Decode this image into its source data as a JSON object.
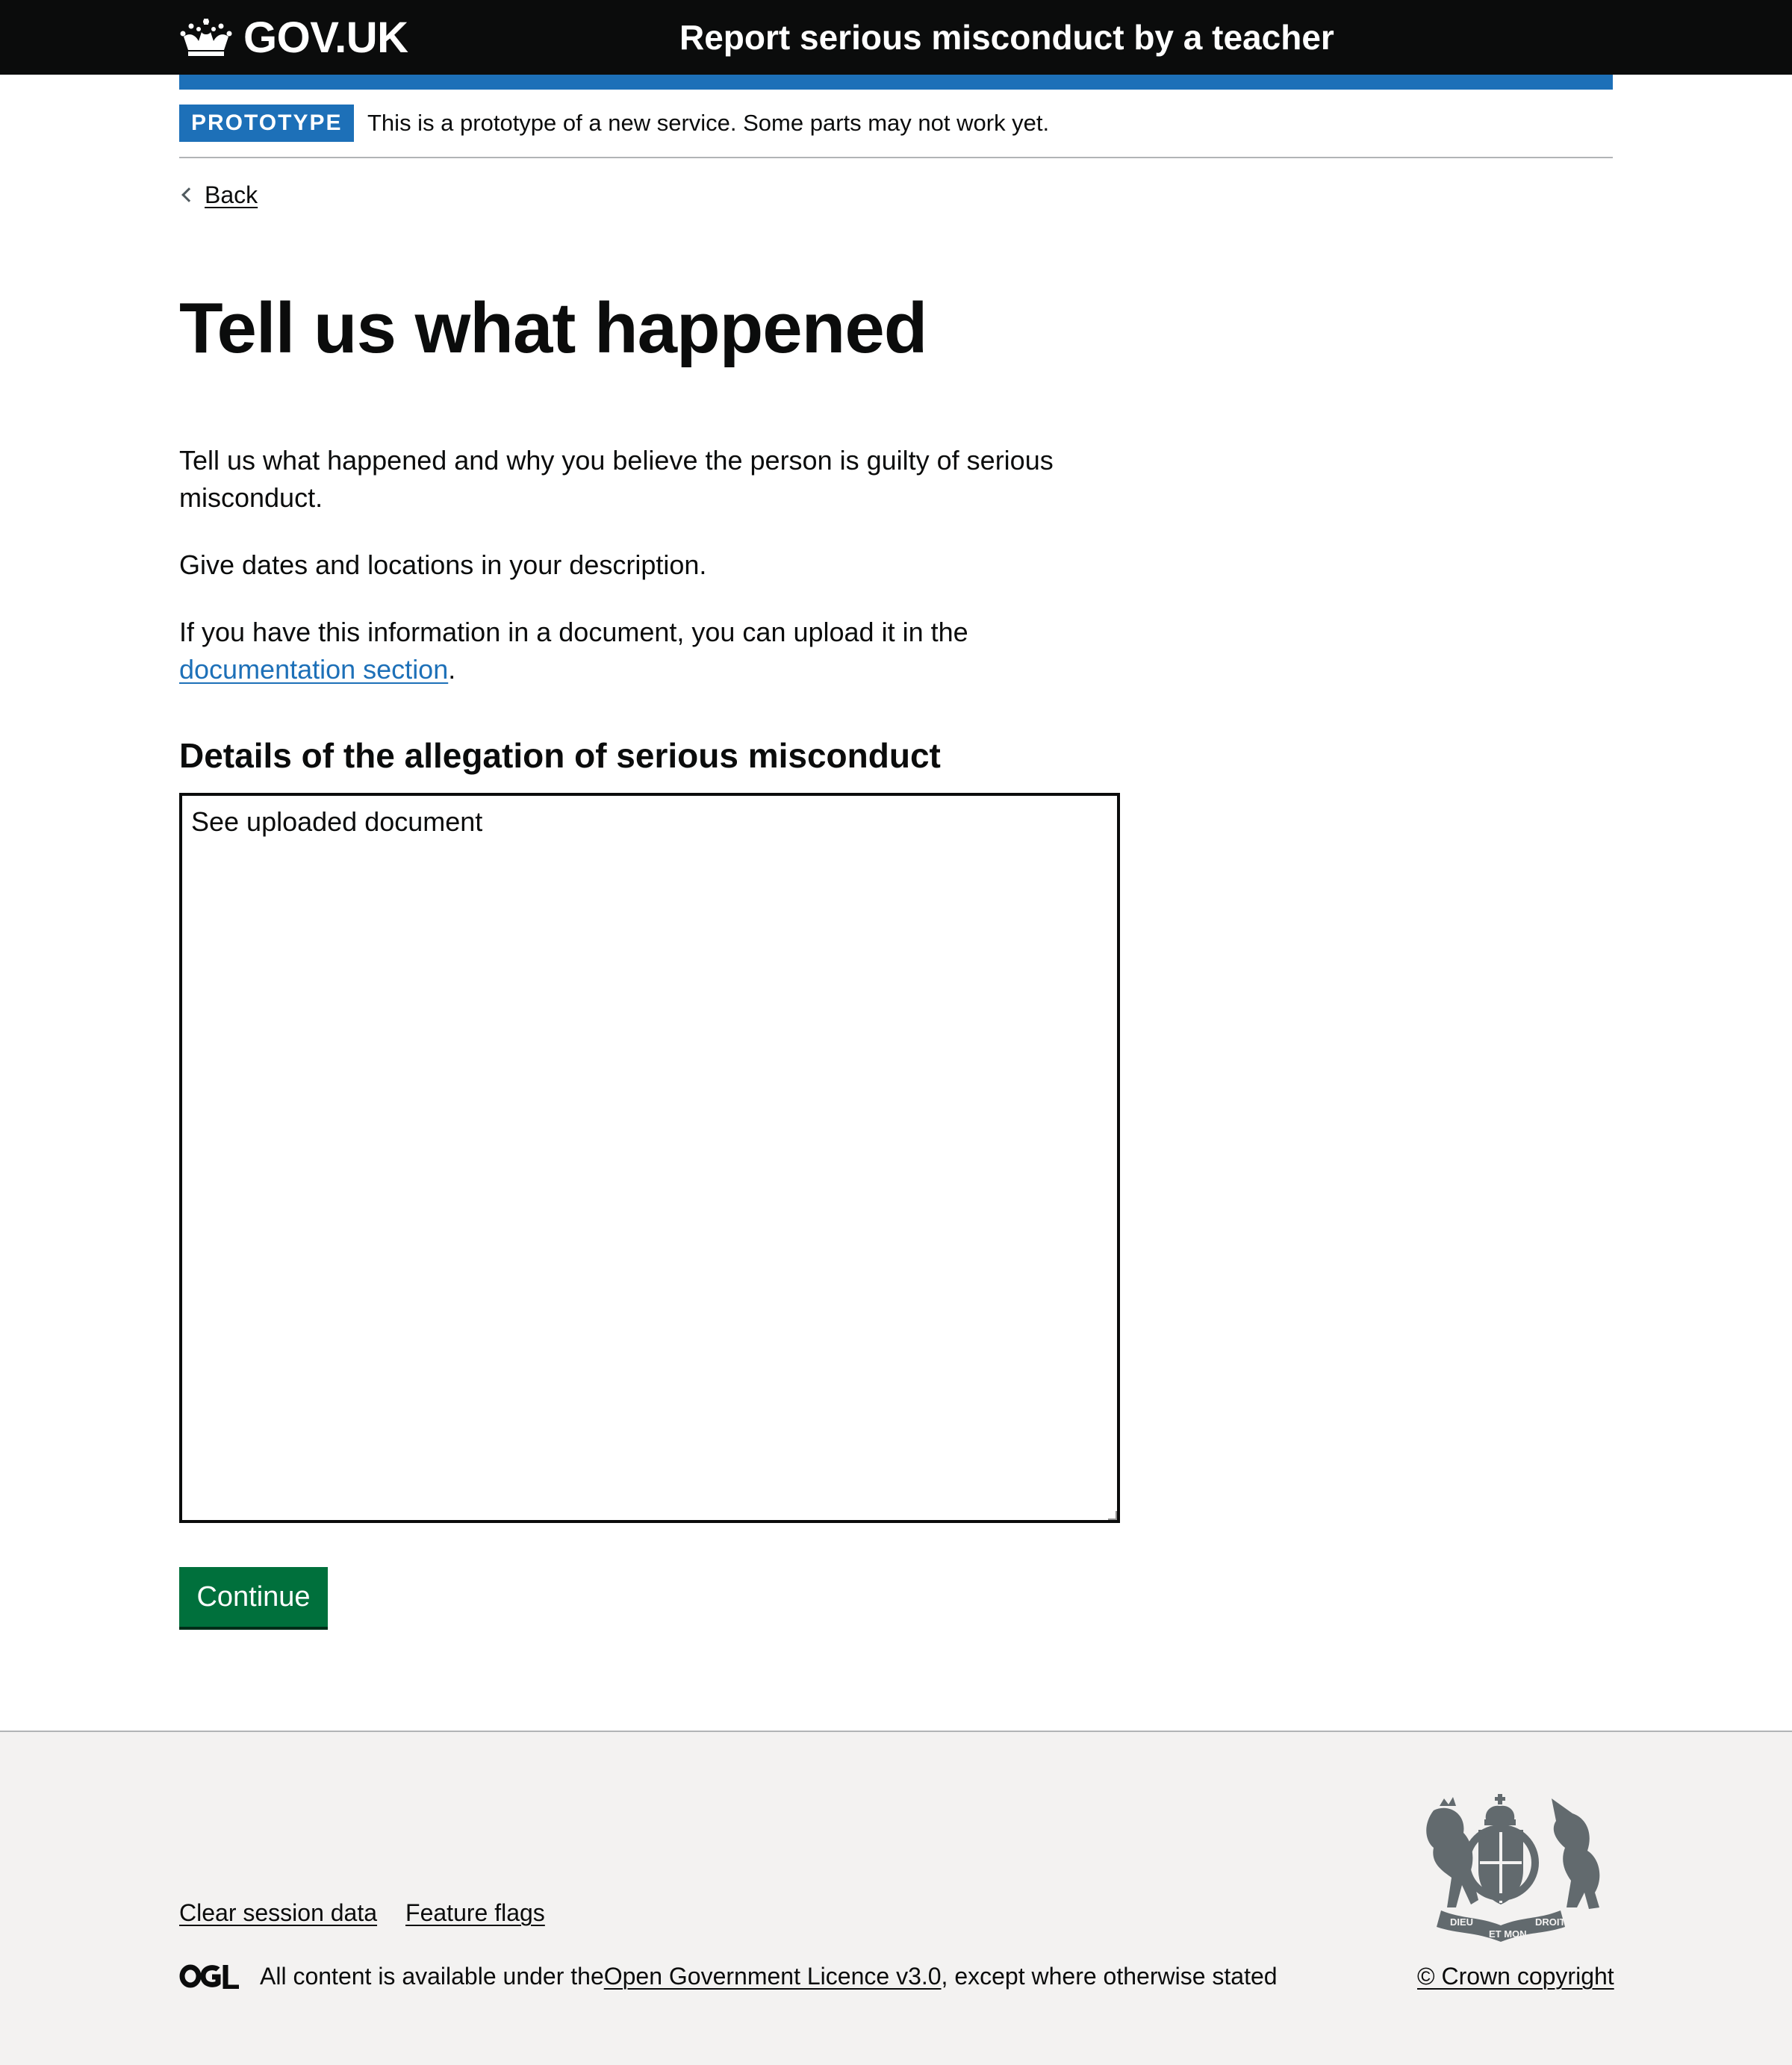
{
  "header": {
    "logo_text": "GOV.UK",
    "service_name": "Report serious misconduct by a teacher",
    "logo_icon": "crown-icon"
  },
  "phase_banner": {
    "tag": "PROTOTYPE",
    "text": "This is a prototype of a new service. Some parts may not work yet."
  },
  "back_link": {
    "label": "Back",
    "icon": "chevron-left-icon"
  },
  "main": {
    "title": "Tell us what happened",
    "paragraph1": "Tell us what happened and why you believe the person is guilty of serious misconduct.",
    "paragraph2": "Give dates and locations in your description.",
    "paragraph3_before": "If you have this information in a document, you can upload it in the ",
    "paragraph3_link": "documentation section",
    "paragraph3_after": ".",
    "field_label": "Details of the allegation of serious misconduct",
    "field_value": "See uploaded document",
    "continue_label": "Continue"
  },
  "footer": {
    "links": [
      "Clear session data",
      "Feature flags"
    ],
    "licence_before": "All content is available under the ",
    "licence_link": "Open Government Licence v3.0",
    "licence_after": ", except where otherwise stated",
    "copyright": "© Crown copyright",
    "crest_icon": "royal-coat-of-arms-icon",
    "ogl_icon": "ogl-logo-icon",
    "crest_motto_left": "DIEU",
    "crest_motto_center": "ET MON",
    "crest_motto_right": "DROIT"
  },
  "colors": {
    "header_bg": "#0b0c0c",
    "brand_blue": "#1d70b8",
    "button_green": "#00703c",
    "footer_bg": "#f3f2f1",
    "text": "#0b0c0c"
  }
}
